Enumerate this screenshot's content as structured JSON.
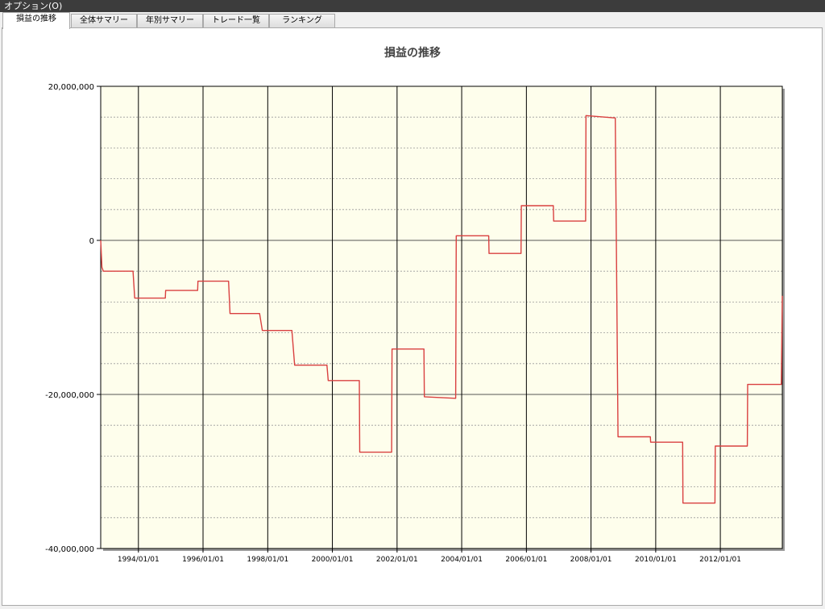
{
  "menubar": {
    "label": "オプション(O)"
  },
  "tabs": [
    {
      "label": "損益の推移",
      "active": true
    },
    {
      "label": "全体サマリー",
      "active": false
    },
    {
      "label": "年別サマリー",
      "active": false
    },
    {
      "label": "トレード一覧",
      "active": false
    },
    {
      "label": "ランキング",
      "active": false
    }
  ],
  "colors": {
    "plot_background": "#fefeec",
    "line": "#d94040"
  },
  "chart_data": {
    "type": "line",
    "title": "損益の推移",
    "xlabel": "",
    "ylabel": "",
    "ylim": [
      -40000000,
      20000000
    ],
    "xlim": [
      "1992/11/01",
      "2013/12/01"
    ],
    "yticks": [
      20000000,
      0,
      -20000000,
      -40000000
    ],
    "ytick_labels": [
      "20,000,000",
      "0",
      "-20,000,000",
      "-40,000,000"
    ],
    "xticks": [
      "1994/01/01",
      "1996/01/01",
      "1998/01/01",
      "2000/01/01",
      "2002/01/01",
      "2004/01/01",
      "2006/01/01",
      "2008/01/01",
      "2010/01/01",
      "2012/01/01"
    ],
    "grid": true,
    "legend": "none",
    "series": [
      {
        "step": true,
        "x": [
          "1992/11/01",
          "1992/11/15",
          "1992/12/01",
          "1993/11/01",
          "1993/11/20",
          "1994/11/01",
          "1994/11/05",
          "1995/11/01",
          "1995/11/05",
          "1996/10/15",
          "1996/11/01",
          "1997/10/01",
          "1997/11/01",
          "1998/10/01",
          "1998/11/01",
          "1999/11/01",
          "1999/11/15",
          "2000/11/01",
          "2000/11/05",
          "2001/11/01",
          "2001/11/05",
          "2002/11/01",
          "2002/11/05",
          "2003/10/25",
          "2003/11/01",
          "2004/11/01",
          "2004/11/05",
          "2005/11/01",
          "2005/11/05",
          "2006/11/01",
          "2006/11/05",
          "2007/11/01",
          "2007/11/05",
          "2008/10/01",
          "2008/11/01",
          "2009/11/01",
          "2009/11/05",
          "2010/11/01",
          "2010/11/05",
          "2011/11/01",
          "2011/11/05",
          "2012/11/01",
          "2012/11/05",
          "2013/11/20",
          "2013/12/01"
        ],
        "y": [
          0,
          -3500000,
          -4000000,
          -4000000,
          -7500000,
          -7500000,
          -6500000,
          -6500000,
          -5300000,
          -5300000,
          -9500000,
          -9500000,
          -11700000,
          -11700000,
          -16200000,
          -16200000,
          -18200000,
          -18200000,
          -27500000,
          -27500000,
          -14100000,
          -14100000,
          -20300000,
          -20500000,
          600000,
          600000,
          -1700000,
          -1700000,
          4500000,
          4500000,
          2500000,
          2500000,
          16200000,
          15900000,
          -25500000,
          -25500000,
          -26200000,
          -26200000,
          -34100000,
          -34100000,
          -26700000,
          -26700000,
          -18700000,
          -18700000,
          -7200000
        ]
      }
    ]
  }
}
